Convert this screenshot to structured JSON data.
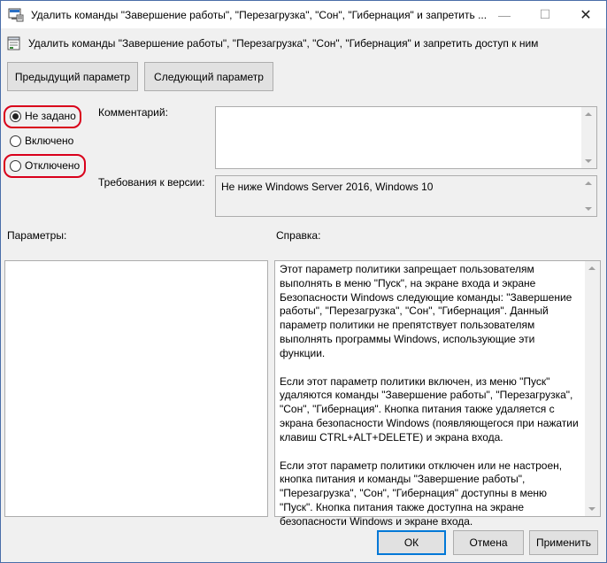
{
  "window": {
    "title": "Удалить команды \"Завершение работы\", \"Перезагрузка\", \"Сон\", \"Гибернация\" и запретить ...",
    "minimize": "—",
    "maximize": "☐",
    "close": "✕"
  },
  "header": {
    "policy_name": "Удалить команды \"Завершение работы\", \"Перезагрузка\", \"Сон\", \"Гибернация\" и запретить доступ к ним"
  },
  "nav": {
    "prev_label": "Предыдущий параметр",
    "next_label": "Следующий параметр"
  },
  "state": {
    "selected": "not_configured",
    "not_configured_label": "Не задано",
    "enabled_label": "Включено",
    "disabled_label": "Отключено"
  },
  "comment": {
    "label": "Комментарий:",
    "value": ""
  },
  "supported": {
    "label": "Требования к версии:",
    "value": "Не ниже Windows Server 2016, Windows 10"
  },
  "options": {
    "label": "Параметры:"
  },
  "help": {
    "label": "Справка:",
    "paragraphs": [
      "Этот параметр политики запрещает пользователям выполнять в меню \"Пуск\", на экране входа и экране Безопасности Windows следующие команды: \"Завершение работы\", \"Перезагрузка\", \"Сон\", \"Гибернация\". Данный параметр политики не препятствует пользователям выполнять программы Windows, использующие эти функции.",
      "Если этот параметр политики включен, из меню \"Пуск\" удаляются команды \"Завершение работы\", \"Перезагрузка\", \"Сон\", \"Гибернация\". Кнопка питания также удаляется с экрана безопасности Windows (появляющегося при нажатии клавиш CTRL+ALT+DELETE) и экрана входа.",
      "Если этот параметр политики отключен или не настроен, кнопка питания и команды \"Завершение работы\", \"Перезагрузка\", \"Сон\", \"Гибернация\" доступны в меню \"Пуск\". Кнопка питания также доступна на экране безопасности Windows и экране входа."
    ]
  },
  "footer": {
    "ok_label": "ОК",
    "cancel_label": "Отмена",
    "apply_label": "Применить"
  },
  "colors": {
    "highlight_oval": "#d9001b",
    "primary_border": "#0078d7"
  }
}
